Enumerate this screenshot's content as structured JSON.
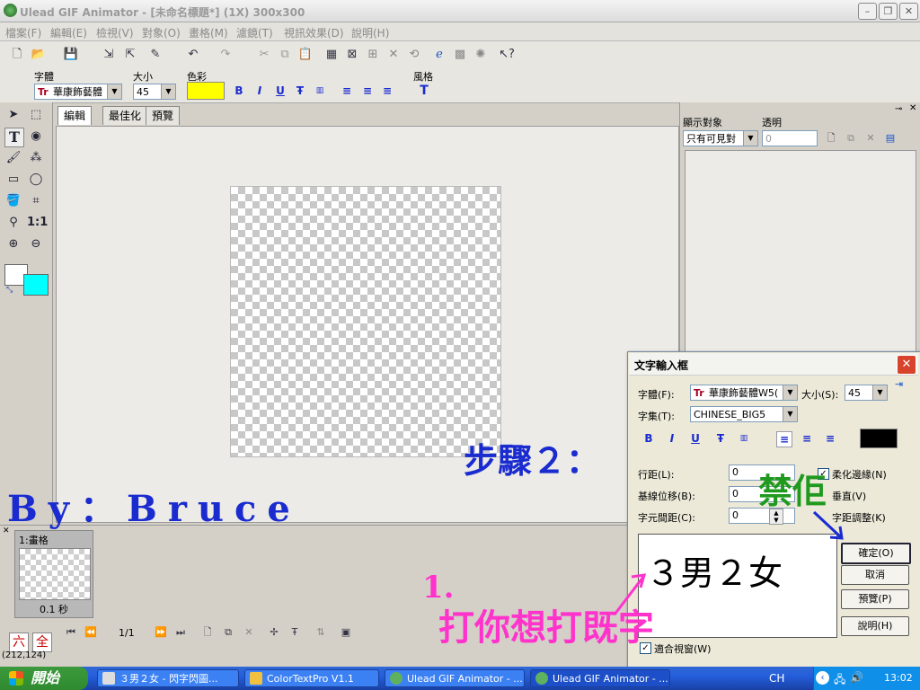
{
  "app": {
    "title": "Ulead GIF Animator - [未命名標題*] (1X) 300x300"
  },
  "menu": [
    "檔案(F)",
    "編輯(E)",
    "檢視(V)",
    "對象(O)",
    "畫格(M)",
    "濾鏡(T)",
    "視訊效果(D)",
    "說明(H)"
  ],
  "text_toolbar": {
    "font_label": "字體",
    "font_value": "華康飾藝體",
    "size_label": "大小",
    "size_value": "45",
    "color_label": "色彩",
    "color_value": "#ffff00",
    "style_label": "風格"
  },
  "tabs": [
    "編輯",
    "最佳化",
    "預覽"
  ],
  "right_panel": {
    "show_label": "顯示對象",
    "opacity_label": "透明",
    "show_value": "只有可見對",
    "opacity_value": "0"
  },
  "colors": {
    "foreground": "#ffffff",
    "background": "#00ffff",
    "accent": "#1a2bd0",
    "annotation_magenta": "#ff33cc",
    "annotation_green": "#1f9a1f"
  },
  "frames": {
    "frame_title": "1:畫格",
    "frame_delay": "0.1 秒",
    "frame_counter": "1/1",
    "coords": "(212,124)",
    "ime_a": "六",
    "ime_b": "全"
  },
  "dialog": {
    "title": "文字輸入框",
    "font_label": "字體(F):",
    "font_value": "華康飾藝體W5(",
    "size_label": "大小(S):",
    "size_value": "45",
    "charset_label": "字集(T):",
    "charset_value": "CHINESE_BIG5",
    "text_color": "#000000",
    "line_spacing_label": "行距(L):",
    "line_spacing_value": "0",
    "baseline_label": "基線位移(B):",
    "baseline_value": "0",
    "char_spacing_label": "字元間距(C):",
    "char_spacing_value": "0",
    "antialias_label": "柔化邊緣(N)",
    "vertical_label": "垂直(V)",
    "kerning_label": "字距調整(K)",
    "preview_text": "３男２女",
    "ok_label": "確定(O)",
    "cancel_label": "取消",
    "preview_label": "預覽(P)",
    "help_label": "說明(H)",
    "fit_label": "適合視窗(W)"
  },
  "annotations": {
    "step": "步驟２：",
    "author": "By：Bruce",
    "num": "1.",
    "instruction": "打你想打既字",
    "press": "禁佢"
  },
  "taskbar": {
    "start_label": "開始",
    "tasks": [
      "３男２女 - 閃字閃圖...",
      "ColorTextPro V1.1",
      "Ulead GIF Animator - ...",
      "Ulead GIF Animator - ..."
    ],
    "lang": "CH",
    "clock": "13:02"
  }
}
